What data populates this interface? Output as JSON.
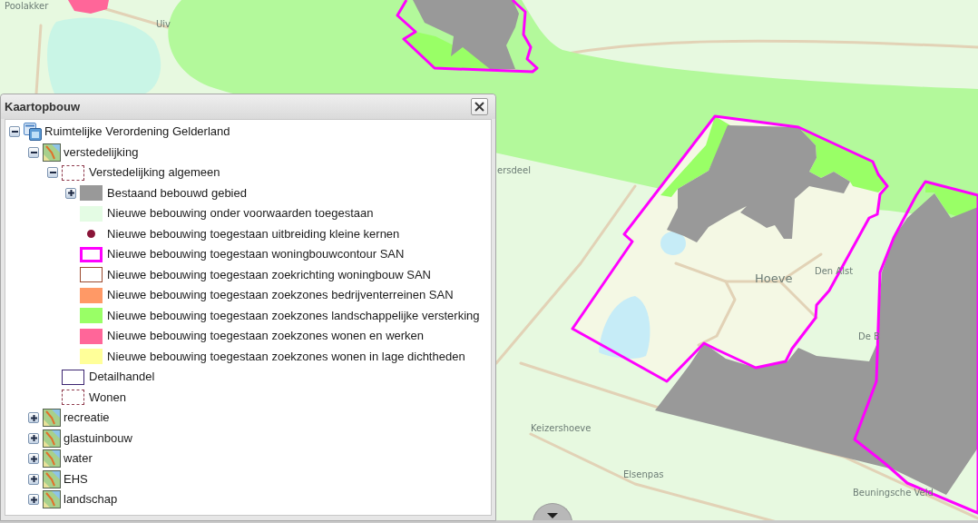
{
  "map": {
    "labels": [
      "Poolakker",
      "Uiv",
      "ersdeel",
      "Hoeve",
      "Den Alst",
      "De B",
      "Keizershoeve",
      "Elsenpas",
      "Beuningsche Veld"
    ]
  },
  "panel": {
    "title": "Kaartopbouw",
    "tree": [
      {
        "label": "Ruimtelijke Verordening Gelderland",
        "kind": "service",
        "expanded": true,
        "children": [
          {
            "label": "verstedelijking",
            "kind": "map_layer",
            "expanded": true,
            "children": [
              {
                "label": "Verstedelijking algemeen",
                "kind": "dashed",
                "color": "#8e3a4c",
                "expanded": true,
                "children": [
                  {
                    "label": "Bestaand bebouwd gebied",
                    "kind": "fill",
                    "color": "#999999",
                    "expanded": false
                  },
                  {
                    "label": "Nieuwe bebouwing onder voorwaarden toegestaan",
                    "kind": "fill",
                    "color": "#e4fce4"
                  },
                  {
                    "label": "Nieuwe bebouwing toegestaan uitbreiding kleine kernen",
                    "kind": "dot",
                    "color": "#8a1538"
                  },
                  {
                    "label": "Nieuwe bebouwing toegestaan woningbouwcontour SAN",
                    "kind": "bold_outline",
                    "color": "#ff00ff"
                  },
                  {
                    "label": "Nieuwe bebouwing toegestaan zoekrichting woningbouw SAN",
                    "kind": "outline",
                    "color": "#9c4a2e"
                  },
                  {
                    "label": "Nieuwe bebouwing toegestaan zoekzones bedrijventerreinen SAN",
                    "kind": "fill",
                    "color": "#ff9966"
                  },
                  {
                    "label": "Nieuwe bebouwing toegestaan zoekzones landschappelijke versterking",
                    "kind": "fill",
                    "color": "#99ff66"
                  },
                  {
                    "label": "Nieuwe bebouwing toegestaan zoekzones wonen en werken",
                    "kind": "fill",
                    "color": "#ff6699"
                  },
                  {
                    "label": "Nieuwe bebouwing toegestaan zoekzones wonen in lage dichtheden",
                    "kind": "fill",
                    "color": "#ffff99"
                  }
                ]
              },
              {
                "label": "Detailhandel",
                "kind": "outline",
                "color": "#3c2470"
              },
              {
                "label": "Wonen",
                "kind": "dashed",
                "color": "#8e3a4c"
              }
            ]
          },
          {
            "label": "recreatie",
            "kind": "map_layer",
            "expanded": false
          },
          {
            "label": "glastuinbouw",
            "kind": "map_layer",
            "expanded": false
          },
          {
            "label": "water",
            "kind": "map_layer",
            "expanded": false
          },
          {
            "label": "EHS",
            "kind": "map_layer",
            "expanded": false
          },
          {
            "label": "landschap",
            "kind": "map_layer",
            "expanded": false
          }
        ]
      }
    ]
  }
}
